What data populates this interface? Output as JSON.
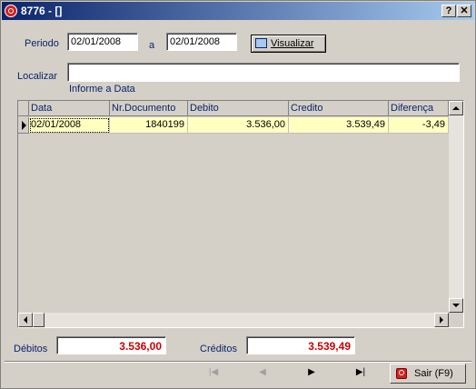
{
  "window": {
    "title": "8776 - []",
    "help_label": "?",
    "close_label": "✕"
  },
  "filter": {
    "periodo_label": "Periodo",
    "date_from": "02/01/2008",
    "a_label": "a",
    "date_to": "02/01/2008",
    "visualizar_label": "Visualizar",
    "localizar_label": "Localizar",
    "localizar_value": "",
    "hint": "Informe a Data"
  },
  "grid": {
    "columns": [
      "Data",
      "Nr.Documento",
      "Debito",
      "Credito",
      "Diferença"
    ],
    "rows": [
      {
        "data": "02/01/2008",
        "documento": "1840199",
        "debito": "3.536,00",
        "credito": "3.539,49",
        "diferenca": "-3,49"
      }
    ]
  },
  "totals": {
    "debitos_label": "Débitos",
    "debitos_value": "3.536,00",
    "creditos_label": "Créditos",
    "creditos_value": "3.539,49"
  },
  "nav": {
    "first": "|◀",
    "prev": "◀",
    "next": "▶",
    "last": "▶|"
  },
  "exit": {
    "label": "Sair (F9)"
  },
  "colors": {
    "accent": "#0a246a",
    "total_text": "#cc0000",
    "row_highlight": "#ffffc0"
  }
}
